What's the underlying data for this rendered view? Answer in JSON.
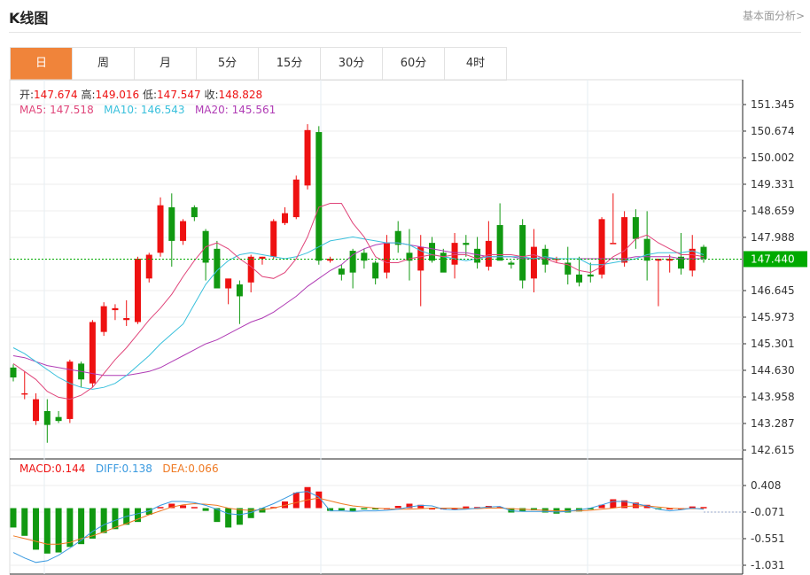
{
  "header": {
    "title": "K线图",
    "basic_link": "基本面分析>"
  },
  "tabs": [
    {
      "label": "日",
      "active": true
    },
    {
      "label": "周",
      "active": false
    },
    {
      "label": "月",
      "active": false
    },
    {
      "label": "5分",
      "active": false
    },
    {
      "label": "15分",
      "active": false
    },
    {
      "label": "30分",
      "active": false
    },
    {
      "label": "60分",
      "active": false
    },
    {
      "label": "4时",
      "active": false
    }
  ],
  "ohlc_info": {
    "open_label": "开:",
    "open": "147.674",
    "high_label": "高:",
    "high": "149.016",
    "low_label": "低:",
    "low": "147.547",
    "close_label": "收:",
    "close": "148.828"
  },
  "ma_info": {
    "ma5_label": "MA5:",
    "ma5": "147.518",
    "ma10_label": "MA10:",
    "ma10": "146.543",
    "ma20_label": "MA20:",
    "ma20": "145.561"
  },
  "macd_info": {
    "macd_label": "MACD:",
    "macd": "0.144",
    "diff_label": "DIFF:",
    "diff": "0.138",
    "dea_label": "DEA:",
    "dea": "0.066"
  },
  "colors": {
    "up": "#ee1111",
    "down": "#119911",
    "ma5": "#e0457a",
    "ma10": "#39c0dc",
    "ma20": "#b03cb5",
    "diff": "#3a9ae0",
    "dea": "#ef7a24",
    "current_price": "#00aa00",
    "active_tab": "#f0843a"
  },
  "chart_data": {
    "type": "candlestick",
    "current_price": "147.440",
    "price_ticks": [
      "151.345",
      "150.674",
      "150.002",
      "149.331",
      "148.659",
      "147.988",
      "146.645",
      "145.973",
      "145.301",
      "144.630",
      "143.958",
      "143.287",
      "142.615"
    ],
    "price_ylim": [
      142.615,
      151.345
    ],
    "macd_ticks": [
      "0.408",
      "-0.071",
      "-0.551",
      "-1.031"
    ],
    "macd_ylim": [
      -1.031,
      0.408
    ],
    "candles": [
      [
        144.7,
        144.78,
        144.35,
        144.45
      ],
      [
        144.05,
        144.6,
        143.9,
        144.05
      ],
      [
        143.35,
        144.05,
        143.25,
        143.9
      ],
      [
        143.6,
        143.9,
        142.8,
        143.25
      ],
      [
        143.45,
        143.6,
        143.3,
        143.35
      ],
      [
        143.4,
        144.9,
        143.3,
        144.85
      ],
      [
        144.8,
        144.85,
        144.2,
        144.4
      ],
      [
        144.3,
        145.9,
        144.2,
        145.85
      ],
      [
        145.6,
        146.35,
        145.5,
        146.25
      ],
      [
        146.15,
        146.3,
        145.9,
        146.2
      ],
      [
        145.9,
        146.4,
        145.75,
        145.95
      ],
      [
        145.85,
        147.5,
        145.8,
        147.45
      ],
      [
        146.95,
        147.6,
        146.85,
        147.55
      ],
      [
        147.6,
        149.0,
        147.5,
        148.8
      ],
      [
        148.75,
        149.1,
        147.25,
        147.9
      ],
      [
        147.9,
        148.45,
        147.8,
        148.4
      ],
      [
        148.75,
        148.8,
        148.4,
        148.5
      ],
      [
        148.15,
        148.2,
        146.9,
        147.35
      ],
      [
        147.7,
        147.9,
        146.8,
        146.7
      ],
      [
        146.7,
        146.85,
        146.3,
        146.95
      ],
      [
        146.8,
        146.9,
        145.8,
        146.5
      ],
      [
        146.85,
        147.55,
        146.6,
        147.5
      ],
      [
        147.45,
        147.5,
        147.3,
        147.5
      ],
      [
        147.5,
        148.45,
        147.45,
        148.4
      ],
      [
        148.35,
        148.75,
        148.3,
        148.6
      ],
      [
        148.5,
        149.55,
        148.45,
        149.45
      ],
      [
        149.3,
        150.85,
        149.2,
        150.7
      ],
      [
        150.65,
        150.8,
        147.3,
        147.4
      ],
      [
        147.4,
        147.5,
        147.35,
        147.45
      ],
      [
        147.2,
        147.3,
        146.9,
        147.05
      ],
      [
        147.65,
        147.7,
        146.7,
        147.1
      ],
      [
        147.6,
        147.7,
        147.2,
        147.4
      ],
      [
        147.35,
        147.4,
        146.8,
        146.95
      ],
      [
        147.1,
        148.05,
        146.95,
        147.85
      ],
      [
        148.15,
        148.4,
        147.6,
        147.8
      ],
      [
        147.6,
        148.2,
        146.9,
        147.4
      ],
      [
        147.15,
        148.05,
        146.25,
        147.75
      ],
      [
        147.85,
        148.0,
        147.35,
        147.4
      ],
      [
        147.6,
        147.7,
        147.2,
        147.1
      ],
      [
        147.3,
        148.1,
        146.95,
        147.85
      ],
      [
        147.85,
        148.05,
        147.5,
        147.8
      ],
      [
        147.7,
        148.0,
        147.2,
        147.35
      ],
      [
        147.25,
        148.4,
        147.15,
        147.9
      ],
      [
        148.3,
        148.85,
        147.7,
        147.4
      ],
      [
        147.35,
        147.4,
        147.2,
        147.3
      ],
      [
        148.3,
        148.45,
        146.7,
        146.9
      ],
      [
        146.95,
        148.2,
        146.6,
        147.75
      ],
      [
        147.7,
        147.8,
        147.1,
        147.3
      ],
      [
        147.45,
        147.5,
        147.35,
        147.45
      ],
      [
        147.35,
        147.75,
        146.8,
        147.05
      ],
      [
        147.05,
        147.5,
        146.75,
        146.85
      ],
      [
        147.05,
        147.35,
        146.85,
        147.0
      ],
      [
        147.05,
        148.5,
        146.95,
        148.45
      ],
      [
        147.85,
        149.1,
        147.85,
        147.85
      ],
      [
        147.35,
        148.65,
        147.25,
        148.5
      ],
      [
        148.5,
        148.7,
        147.7,
        147.95
      ],
      [
        147.95,
        148.65,
        146.9,
        147.4
      ],
      [
        147.4,
        147.45,
        146.25,
        147.45
      ],
      [
        147.4,
        147.55,
        147.1,
        147.45
      ],
      [
        147.5,
        148.1,
        147.05,
        147.2
      ],
      [
        147.15,
        148.05,
        147.0,
        147.7
      ],
      [
        147.75,
        147.8,
        147.35,
        147.45
      ]
    ],
    "ma5": [
      144.8,
      144.6,
      144.4,
      144.1,
      143.95,
      143.9,
      144.0,
      144.2,
      144.55,
      144.9,
      145.2,
      145.55,
      145.9,
      146.2,
      146.55,
      147.0,
      147.4,
      147.75,
      147.85,
      147.7,
      147.45,
      147.25,
      147.0,
      146.95,
      147.1,
      147.45,
      148.0,
      148.75,
      148.85,
      148.85,
      148.35,
      148.0,
      147.5,
      147.35,
      147.35,
      147.45,
      147.5,
      147.55,
      147.5,
      147.55,
      147.55,
      147.45,
      147.55,
      147.55,
      147.55,
      147.5,
      147.55,
      147.45,
      147.35,
      147.3,
      147.15,
      147.1,
      147.25,
      147.5,
      147.65,
      147.95,
      148.05,
      147.85,
      147.7,
      147.55,
      147.55,
      147.5
    ],
    "ma10": [
      145.2,
      145.05,
      144.85,
      144.65,
      144.45,
      144.3,
      144.2,
      144.15,
      144.2,
      144.3,
      144.5,
      144.75,
      145.0,
      145.3,
      145.55,
      145.8,
      146.3,
      146.8,
      147.15,
      147.4,
      147.55,
      147.6,
      147.55,
      147.5,
      147.45,
      147.5,
      147.6,
      147.75,
      147.9,
      147.95,
      148.0,
      147.95,
      147.9,
      147.85,
      147.85,
      147.8,
      147.65,
      147.55,
      147.5,
      147.45,
      147.4,
      147.45,
      147.5,
      147.5,
      147.5,
      147.5,
      147.45,
      147.5,
      147.45,
      147.45,
      147.45,
      147.3,
      147.3,
      147.35,
      147.4,
      147.45,
      147.55,
      147.6,
      147.6,
      147.6,
      147.65,
      147.55
    ],
    "ma20": [
      145.0,
      144.95,
      144.85,
      144.75,
      144.7,
      144.65,
      144.6,
      144.55,
      144.5,
      144.5,
      144.5,
      144.55,
      144.6,
      144.7,
      144.85,
      145.0,
      145.15,
      145.3,
      145.4,
      145.55,
      145.7,
      145.85,
      145.95,
      146.1,
      146.3,
      146.5,
      146.75,
      146.95,
      147.15,
      147.3,
      147.55,
      147.7,
      147.8,
      147.85,
      147.85,
      147.8,
      147.75,
      147.7,
      147.65,
      147.6,
      147.6,
      147.55,
      147.5,
      147.5,
      147.5,
      147.45,
      147.45,
      147.45,
      147.45,
      147.45,
      147.45,
      147.45,
      147.45,
      147.45,
      147.45,
      147.5,
      147.5,
      147.5,
      147.5,
      147.45,
      147.45,
      147.45
    ],
    "macd_hist": [
      -0.35,
      -0.5,
      -0.75,
      -0.82,
      -0.8,
      -0.7,
      -0.65,
      -0.55,
      -0.45,
      -0.38,
      -0.3,
      -0.25,
      -0.12,
      0.02,
      0.08,
      0.05,
      0.02,
      -0.05,
      -0.25,
      -0.35,
      -0.3,
      -0.18,
      -0.08,
      0.02,
      0.12,
      0.28,
      0.38,
      0.3,
      -0.05,
      -0.04,
      -0.06,
      -0.02,
      -0.02,
      0.0,
      0.04,
      0.08,
      0.06,
      0.0,
      0.0,
      0.0,
      0.03,
      0.02,
      0.04,
      0.02,
      -0.08,
      -0.06,
      -0.04,
      -0.08,
      -0.1,
      -0.08,
      -0.06,
      -0.02,
      0.06,
      0.16,
      0.14,
      0.1,
      0.06,
      -0.01,
      0.0,
      0.0,
      0.03,
      0.02
    ],
    "diff": [
      -0.8,
      -0.9,
      -0.98,
      -0.95,
      -0.85,
      -0.72,
      -0.58,
      -0.42,
      -0.3,
      -0.22,
      -0.15,
      -0.1,
      -0.05,
      0.05,
      0.12,
      0.12,
      0.1,
      0.05,
      -0.02,
      -0.1,
      -0.12,
      -0.08,
      0.0,
      0.08,
      0.18,
      0.28,
      0.3,
      0.2,
      -0.05,
      -0.05,
      -0.06,
      -0.05,
      -0.05,
      -0.04,
      -0.02,
      0.02,
      0.05,
      0.04,
      -0.02,
      -0.03,
      -0.02,
      0.0,
      0.02,
      0.03,
      -0.05,
      -0.06,
      -0.06,
      -0.06,
      -0.07,
      -0.06,
      -0.03,
      0.0,
      0.06,
      0.12,
      0.12,
      0.08,
      0.04,
      -0.02,
      -0.05,
      -0.03,
      0.0,
      -0.02
    ],
    "dea": [
      -0.5,
      -0.55,
      -0.6,
      -0.65,
      -0.65,
      -0.62,
      -0.55,
      -0.5,
      -0.43,
      -0.35,
      -0.28,
      -0.2,
      -0.12,
      -0.05,
      0.02,
      0.06,
      0.08,
      0.07,
      0.05,
      0.0,
      -0.03,
      -0.04,
      -0.03,
      0.0,
      0.05,
      0.1,
      0.15,
      0.18,
      0.13,
      0.08,
      0.04,
      0.02,
      0.0,
      -0.01,
      -0.02,
      -0.02,
      -0.01,
      0.0,
      0.0,
      0.0,
      -0.01,
      -0.01,
      0.0,
      0.0,
      -0.01,
      -0.02,
      -0.03,
      -0.04,
      -0.05,
      -0.05,
      -0.05,
      -0.04,
      -0.02,
      0.0,
      0.03,
      0.04,
      0.04,
      0.02,
      0.0,
      -0.01,
      -0.01,
      -0.01
    ]
  }
}
